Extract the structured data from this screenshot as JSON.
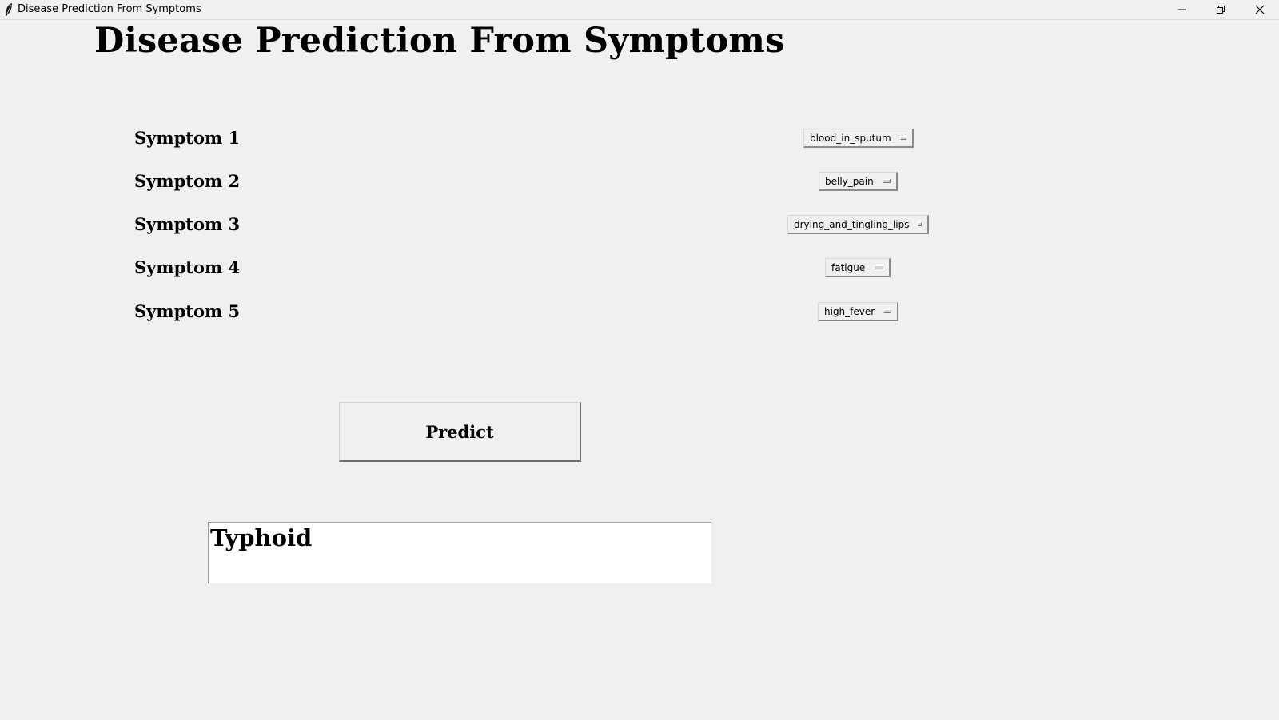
{
  "window": {
    "title": "Disease Prediction From Symptoms"
  },
  "heading": "Disease Prediction From Symptoms",
  "symptoms": [
    {
      "label": "Symptom 1",
      "value": "blood_in_sputum"
    },
    {
      "label": "Symptom 2",
      "value": "belly_pain"
    },
    {
      "label": "Symptom 3",
      "value": "drying_and_tingling_lips"
    },
    {
      "label": "Symptom 4",
      "value": "fatigue"
    },
    {
      "label": "Symptom 5",
      "value": "high_fever"
    }
  ],
  "predict_button": "Predict",
  "result": "Typhoid",
  "icons": {
    "app": "feather-icon",
    "minimize": "minimize-icon",
    "maximize": "restore-icon",
    "close": "close-icon"
  }
}
